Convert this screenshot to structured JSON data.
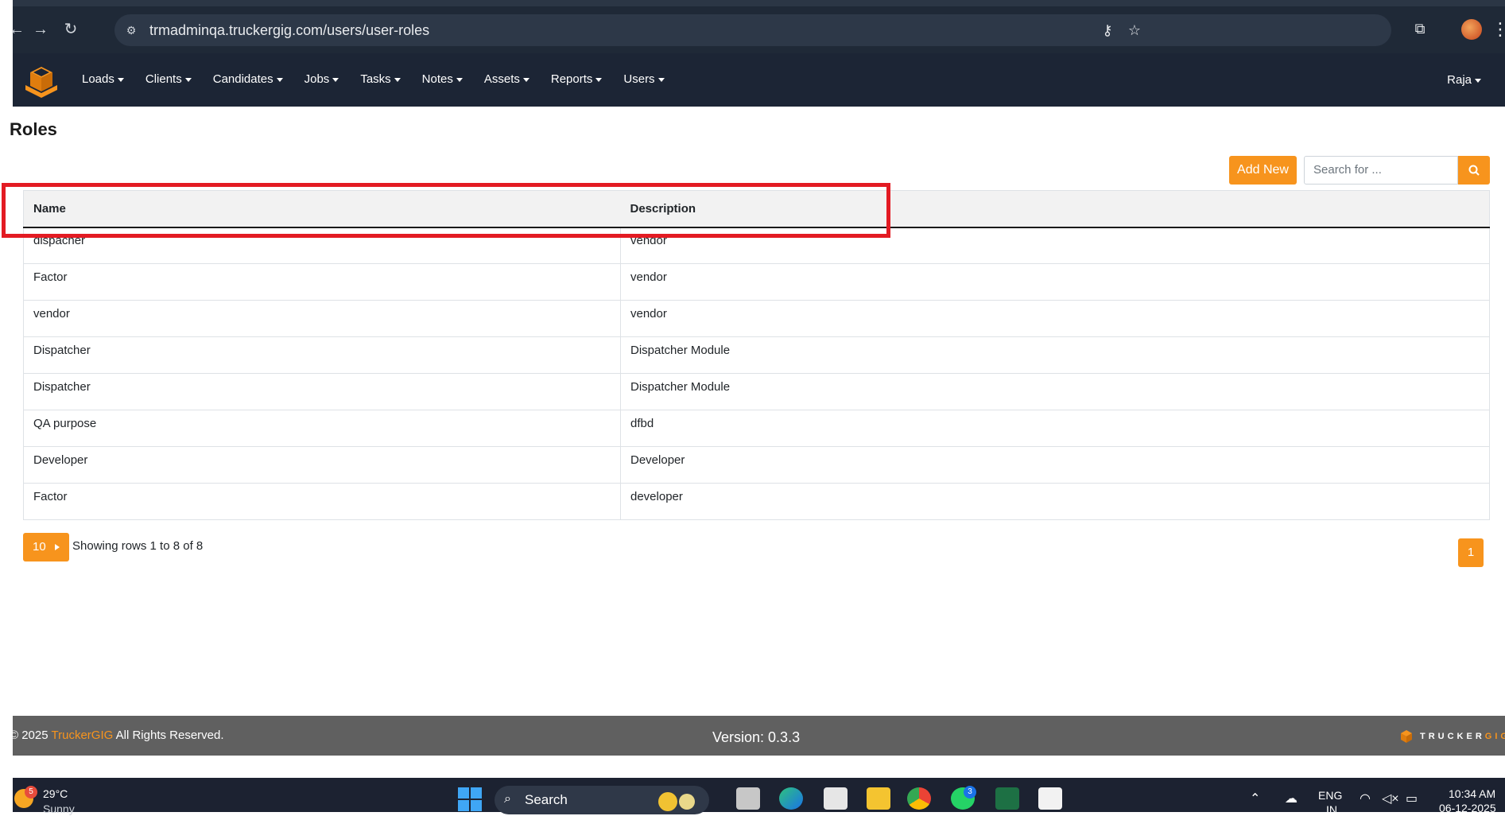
{
  "browser": {
    "url": "trmadminqa.truckergig.com/users/user-roles"
  },
  "navbar": {
    "items": [
      {
        "label": "Loads"
      },
      {
        "label": "Clients"
      },
      {
        "label": "Candidates"
      },
      {
        "label": "Jobs"
      },
      {
        "label": "Tasks"
      },
      {
        "label": "Notes"
      },
      {
        "label": "Assets"
      },
      {
        "label": "Reports"
      },
      {
        "label": "Users"
      }
    ],
    "user": "Raja"
  },
  "page": {
    "title": "Roles",
    "add_new_label": "Add New",
    "search_placeholder": "Search for ..."
  },
  "table": {
    "columns": [
      "Name",
      "Description"
    ],
    "rows": [
      {
        "name": "dispacher",
        "description": "vendor"
      },
      {
        "name": "Factor",
        "description": "vendor"
      },
      {
        "name": "vendor",
        "description": "vendor"
      },
      {
        "name": "Dispatcher",
        "description": "Dispatcher Module"
      },
      {
        "name": "Dispatcher",
        "description": "Dispatcher Module"
      },
      {
        "name": "QA purpose",
        "description": "dfbd"
      },
      {
        "name": "Developer",
        "description": "Developer"
      },
      {
        "name": "Factor",
        "description": "developer"
      }
    ]
  },
  "pagination": {
    "page_size": "10",
    "showing": "Showing rows 1 to 8 of 8",
    "current_page": "1"
  },
  "footer": {
    "copyright_prefix": "© 2025",
    "brand": "TruckerGIG",
    "copyright_suffix": "All Rights Reserved.",
    "version": "Version: 0.3.3",
    "logo_text_main": "TRUCKER",
    "logo_text_accent": "GIG"
  },
  "taskbar": {
    "weather_badge": "5",
    "temperature": "29°C",
    "weather": "Sunny",
    "search_label": "Search",
    "whatsapp_badge": "3",
    "language": "ENG",
    "region": "IN",
    "time": "10:34 AM",
    "date": "06-12-2025"
  },
  "colors": {
    "accent": "#f7941d",
    "navbar": "#1c2535",
    "highlight": "#e31b23",
    "footer": "#606060"
  }
}
